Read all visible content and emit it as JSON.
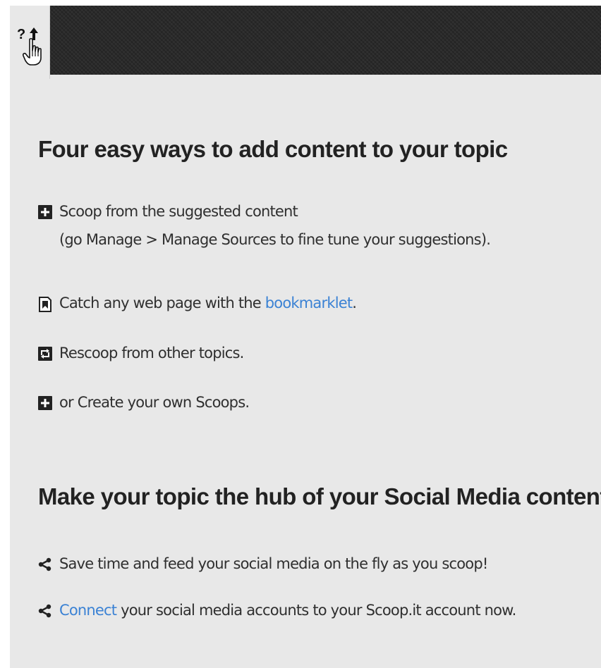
{
  "help_tab": {
    "label": "?"
  },
  "section1": {
    "heading": "Four easy ways to add content to your topic",
    "items": [
      {
        "icon": "plus-square-icon",
        "text": "Scoop from the suggested content",
        "subtext": "(go Manage > Manage Sources to fine tune your suggestions)."
      },
      {
        "icon": "bookmark-icon",
        "text_before": "Catch any web page with the ",
        "link": "bookmarklet",
        "text_after": "."
      },
      {
        "icon": "rescoop-icon",
        "text": "Rescoop from other topics."
      },
      {
        "icon": "plus-square-icon",
        "text": "or Create your own Scoops."
      }
    ]
  },
  "section2": {
    "heading": "Make your topic the hub of your Social Media content",
    "items": [
      {
        "icon": "share-icon",
        "text": "Save time and feed your social media on the fly as you scoop!"
      },
      {
        "icon": "share-icon",
        "link": "Connect",
        "text_after": " your social media accounts to your Scoop.it account now."
      }
    ]
  },
  "colors": {
    "link": "#3b82d4",
    "topbar": "#262626",
    "panel": "#e8e8e8"
  }
}
